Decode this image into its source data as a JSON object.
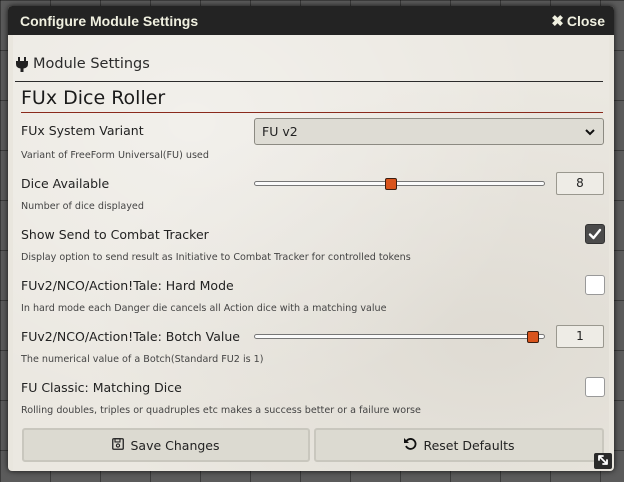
{
  "window": {
    "title": "Configure Module Settings",
    "close_label": "Close"
  },
  "section": {
    "label": "Module Settings",
    "icon": "plug-icon"
  },
  "module": {
    "title": "FUx Dice Roller"
  },
  "settings": [
    {
      "label": "FUx System Variant",
      "hint": "Variant of FreeForm Universal(FU) used",
      "control": "select",
      "value": "FU v2"
    },
    {
      "label": "Dice Available",
      "hint": "Number of dice displayed",
      "control": "range",
      "value": "8",
      "fill_fraction": 0.47
    },
    {
      "label": "Show Send to Combat Tracker",
      "hint": "Display option to send result as Initiative to Combat Tracker for controlled tokens",
      "control": "checkbox",
      "checked": true
    },
    {
      "label": "FUv2/NCO/Action!Tale: Hard Mode",
      "hint": "In hard mode each Danger die cancels all Action dice with a matching value",
      "control": "checkbox",
      "checked": false
    },
    {
      "label": "FUv2/NCO/Action!Tale: Botch Value",
      "hint": "The numerical value of a Botch(Standard FU2 is 1)",
      "control": "range",
      "value": "1",
      "fill_fraction": 0.98
    },
    {
      "label": "FU Classic: Matching Dice",
      "hint": "Rolling doubles, triples or quadruples etc makes a success better or a failure worse",
      "control": "checkbox",
      "checked": false
    }
  ],
  "footer": {
    "save_label": "Save Changes",
    "reset_label": "Reset Defaults"
  },
  "colors": {
    "header_bg": "#232323",
    "accent": "#d9541c",
    "title_rule": "#8a2a1c"
  }
}
